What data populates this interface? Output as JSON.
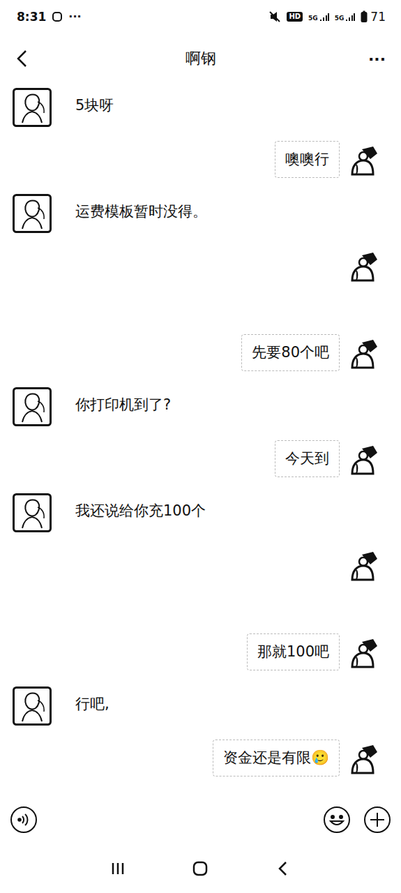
{
  "status_bar": {
    "time": "8:31",
    "more": "···",
    "hd": "HD",
    "network": [
      "5G",
      "5G"
    ],
    "battery": "71"
  },
  "header": {
    "title": "啊钢",
    "more": "···"
  },
  "messages": [
    {
      "side": "left",
      "kind": "text",
      "text": "5块呀"
    },
    {
      "side": "right",
      "kind": "text",
      "text": "噢噢行"
    },
    {
      "side": "left",
      "kind": "text",
      "text": "运费模板暂时没得。"
    },
    {
      "side": "right",
      "kind": "blank",
      "text": ""
    },
    {
      "side": "right",
      "kind": "text",
      "text": "先要80个吧"
    },
    {
      "side": "left",
      "kind": "text",
      "text": "你打印机到了?"
    },
    {
      "side": "right",
      "kind": "text",
      "text": "今天到"
    },
    {
      "side": "left",
      "kind": "text",
      "text": "我还说给你充100个"
    },
    {
      "side": "right",
      "kind": "blank",
      "text": ""
    },
    {
      "side": "right",
      "kind": "text",
      "text": "那就100吧"
    },
    {
      "side": "left",
      "kind": "text",
      "text": "行吧,"
    },
    {
      "side": "right",
      "kind": "text",
      "text": "资金还是有限🥲"
    }
  ]
}
